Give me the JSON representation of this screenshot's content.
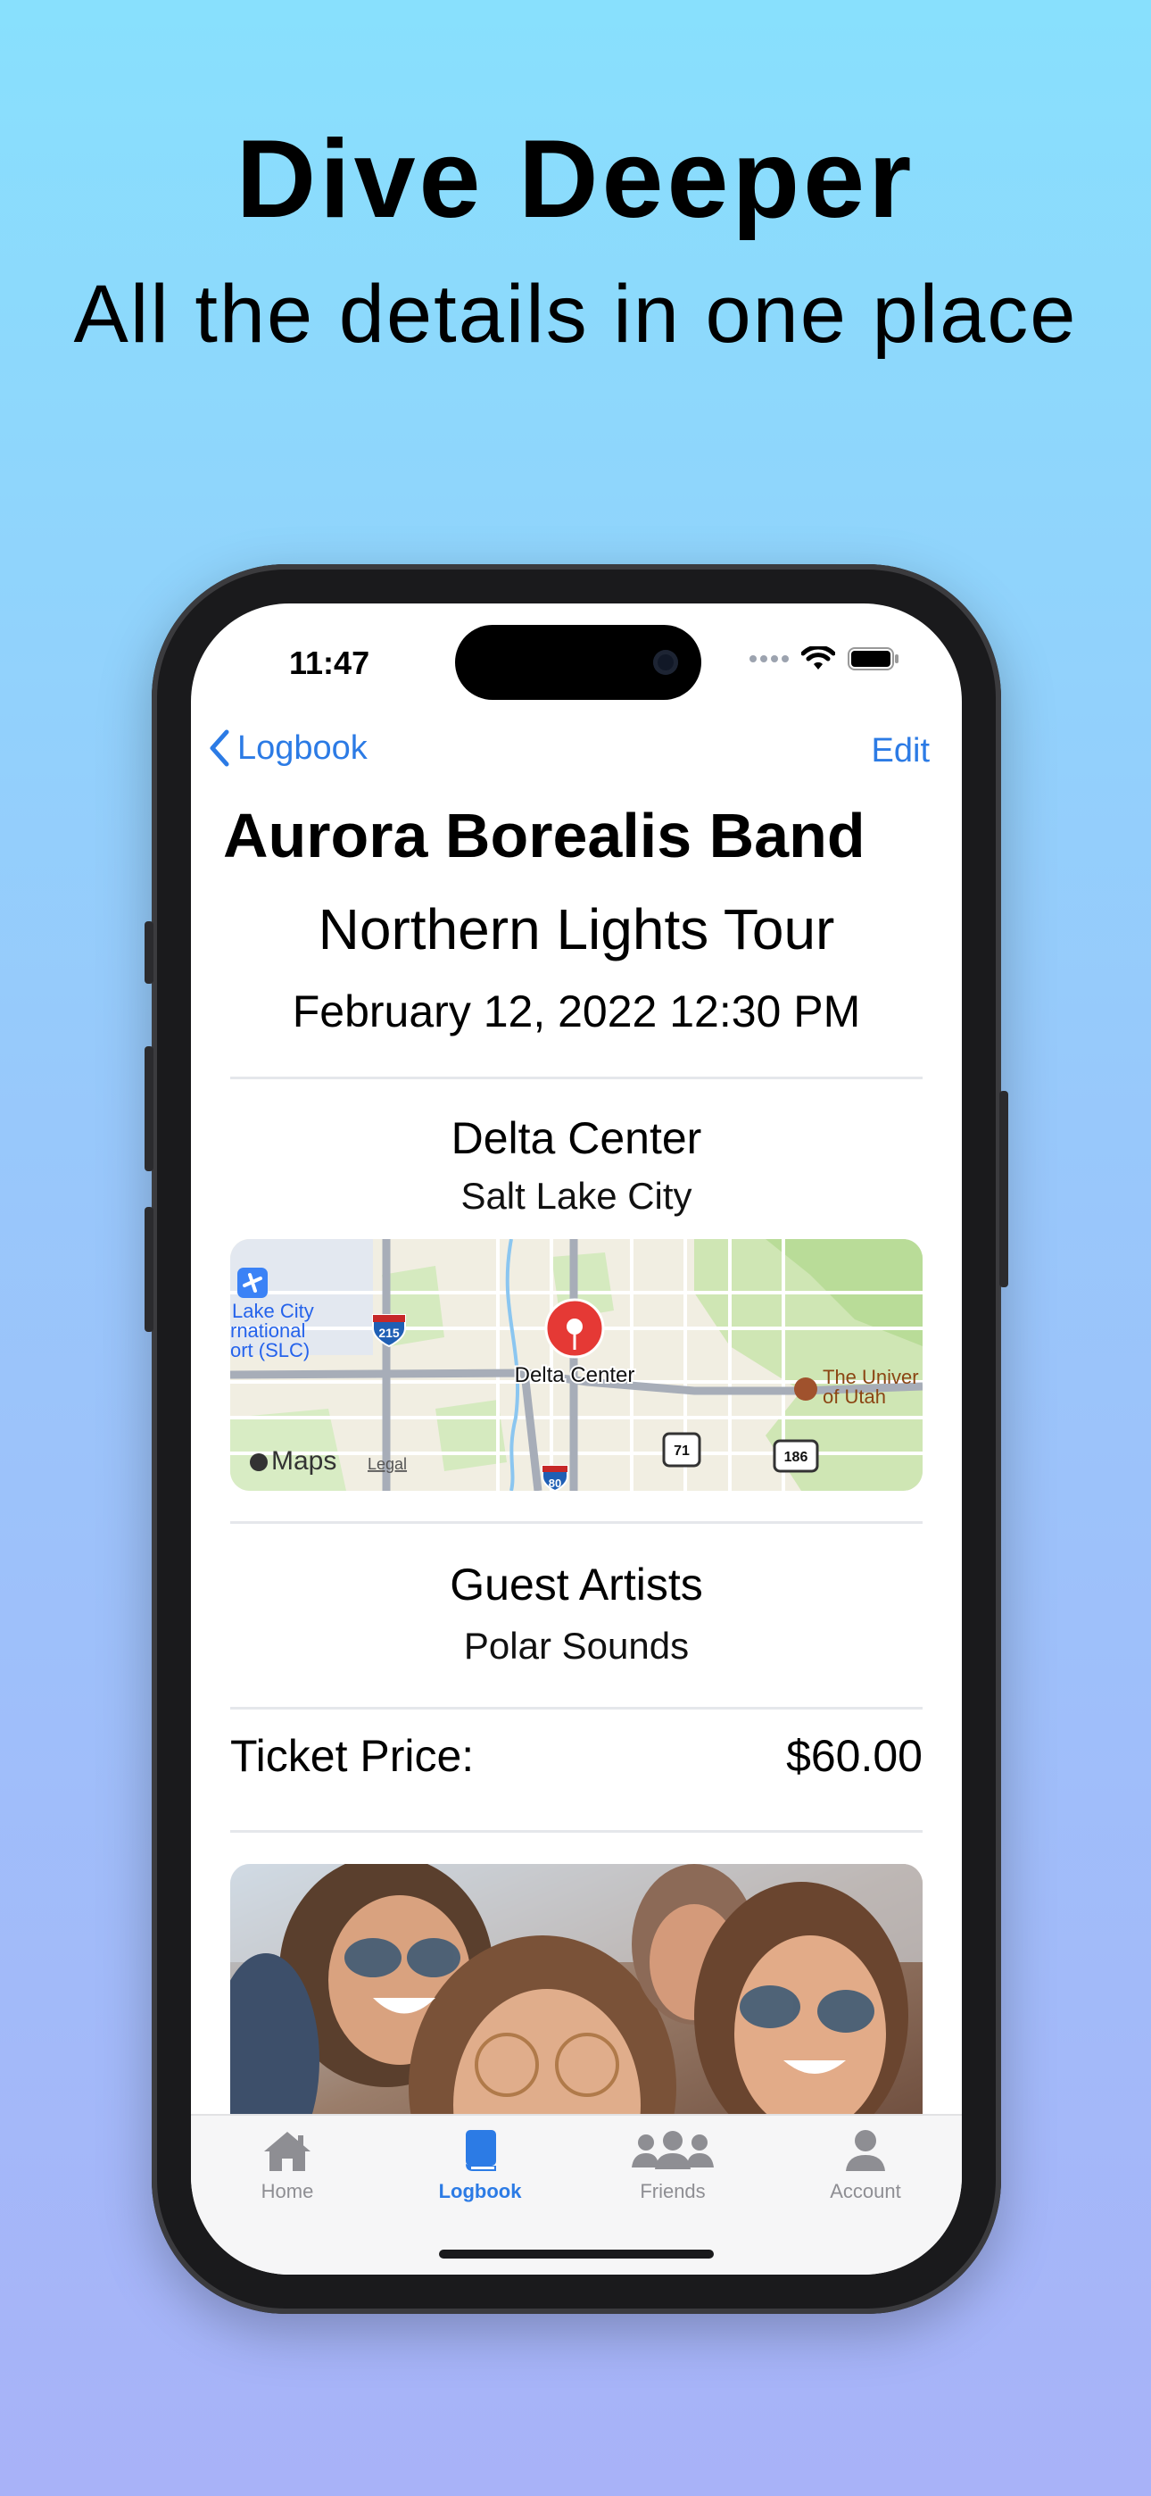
{
  "promo": {
    "headline": "Dive Deeper",
    "subheadline": "All the details in one place"
  },
  "status_bar": {
    "time": "11:47"
  },
  "nav": {
    "back_label": "Logbook",
    "edit_label": "Edit"
  },
  "concert": {
    "band": "Aurora Borealis Band",
    "tour": "Northern Lights Tour",
    "datetime": "February 12, 2022 12:30 PM",
    "venue": "Delta Center",
    "city": "Salt Lake City"
  },
  "map": {
    "pin_label": "Delta Center",
    "airport_label_1": "Lake City",
    "airport_label_2": "rnational",
    "airport_label_3": "ort (SLC)",
    "university_label_1": "The Univer",
    "university_label_2": "of Utah",
    "route_215": "215",
    "route_80": "80",
    "route_71": "71",
    "route_186": "186",
    "maps_logo": "Maps",
    "legal": "Legal"
  },
  "guests": {
    "heading": "Guest Artists",
    "name": "Polar Sounds"
  },
  "ticket": {
    "label": "Ticket Price:",
    "value": "$60.00"
  },
  "tabs": [
    {
      "label": "Home",
      "icon": "house-icon"
    },
    {
      "label": "Logbook",
      "icon": "book-icon"
    },
    {
      "label": "Friends",
      "icon": "people-icon"
    },
    {
      "label": "Account",
      "icon": "person-icon"
    }
  ],
  "colors": {
    "accent": "#2c7be5",
    "pin": "#e53935",
    "background_top": "#88e0fd",
    "background_bottom": "#a8b2f8"
  }
}
